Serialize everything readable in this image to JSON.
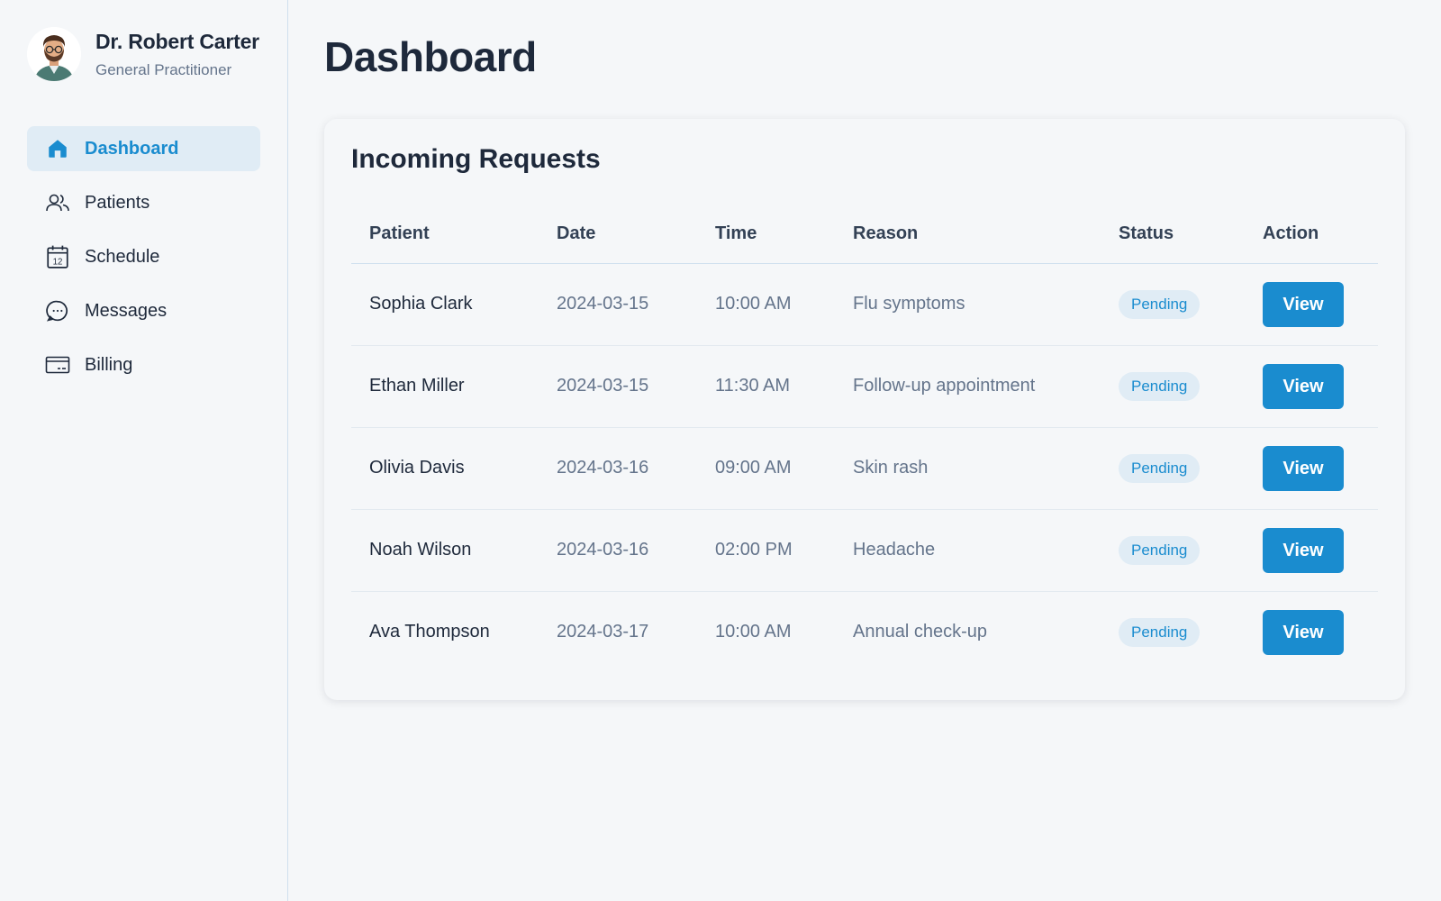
{
  "profile": {
    "name": "Dr. Robert Carter",
    "role": "General Practitioner"
  },
  "nav": {
    "items": [
      {
        "label": "Dashboard",
        "icon": "home-icon",
        "active": true
      },
      {
        "label": "Patients",
        "icon": "users-icon",
        "active": false
      },
      {
        "label": "Schedule",
        "icon": "calendar-icon",
        "active": false
      },
      {
        "label": "Messages",
        "icon": "chat-bubble-icon",
        "active": false
      },
      {
        "label": "Billing",
        "icon": "credit-card-icon",
        "active": false
      }
    ],
    "calendar_day": "12"
  },
  "page": {
    "title": "Dashboard"
  },
  "requests": {
    "title": "Incoming Requests",
    "columns": [
      "Patient",
      "Date",
      "Time",
      "Reason",
      "Status",
      "Action"
    ],
    "rows": [
      {
        "patient": "Sophia Clark",
        "date": "2024-03-15",
        "time": "10:00 AM",
        "reason": "Flu symptoms",
        "status": "Pending",
        "action": "View"
      },
      {
        "patient": "Ethan Miller",
        "date": "2024-03-15",
        "time": "11:30 AM",
        "reason": "Follow-up appointment",
        "status": "Pending",
        "action": "View"
      },
      {
        "patient": "Olivia Davis",
        "date": "2024-03-16",
        "time": "09:00 AM",
        "reason": "Skin rash",
        "status": "Pending",
        "action": "View"
      },
      {
        "patient": "Noah Wilson",
        "date": "2024-03-16",
        "time": "02:00 PM",
        "reason": "Headache",
        "status": "Pending",
        "action": "View"
      },
      {
        "patient": "Ava Thompson",
        "date": "2024-03-17",
        "time": "10:00 AM",
        "reason": "Annual check-up",
        "status": "Pending",
        "action": "View"
      }
    ]
  },
  "colors": {
    "accent": "#1a8ccf",
    "active_bg": "#e0ecf5",
    "background": "#f5f7f9",
    "text_primary": "#1e293b",
    "text_secondary": "#64748b"
  }
}
